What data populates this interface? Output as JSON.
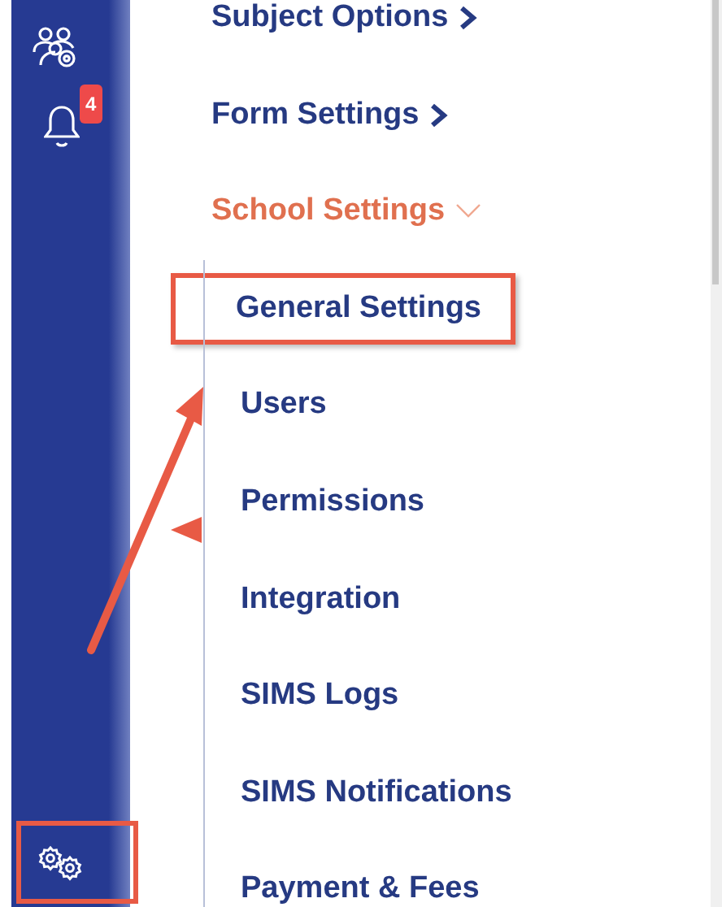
{
  "sidebar": {
    "items": [
      {
        "kind": "users-settings"
      },
      {
        "kind": "notifications",
        "badge": "4"
      }
    ],
    "bottom": {
      "kind": "settings",
      "highlighted": true
    }
  },
  "menu": [
    {
      "label": "Subject Options",
      "kind": "link",
      "expanded": false
    },
    {
      "label": "Form Settings",
      "kind": "link",
      "expanded": false
    },
    {
      "label": "School Settings",
      "kind": "group",
      "expanded": true,
      "children": [
        {
          "label": "General Settings",
          "highlighted": true
        },
        {
          "label": "Users",
          "highlighted": false
        },
        {
          "label": "Permissions",
          "highlighted": false
        },
        {
          "label": "Integration",
          "highlighted": false
        },
        {
          "label": "SIMS Logs",
          "highlighted": false
        },
        {
          "label": "SIMS Notifications",
          "highlighted": false
        },
        {
          "label": "Payment & Fees",
          "highlighted": false
        }
      ]
    }
  ]
}
